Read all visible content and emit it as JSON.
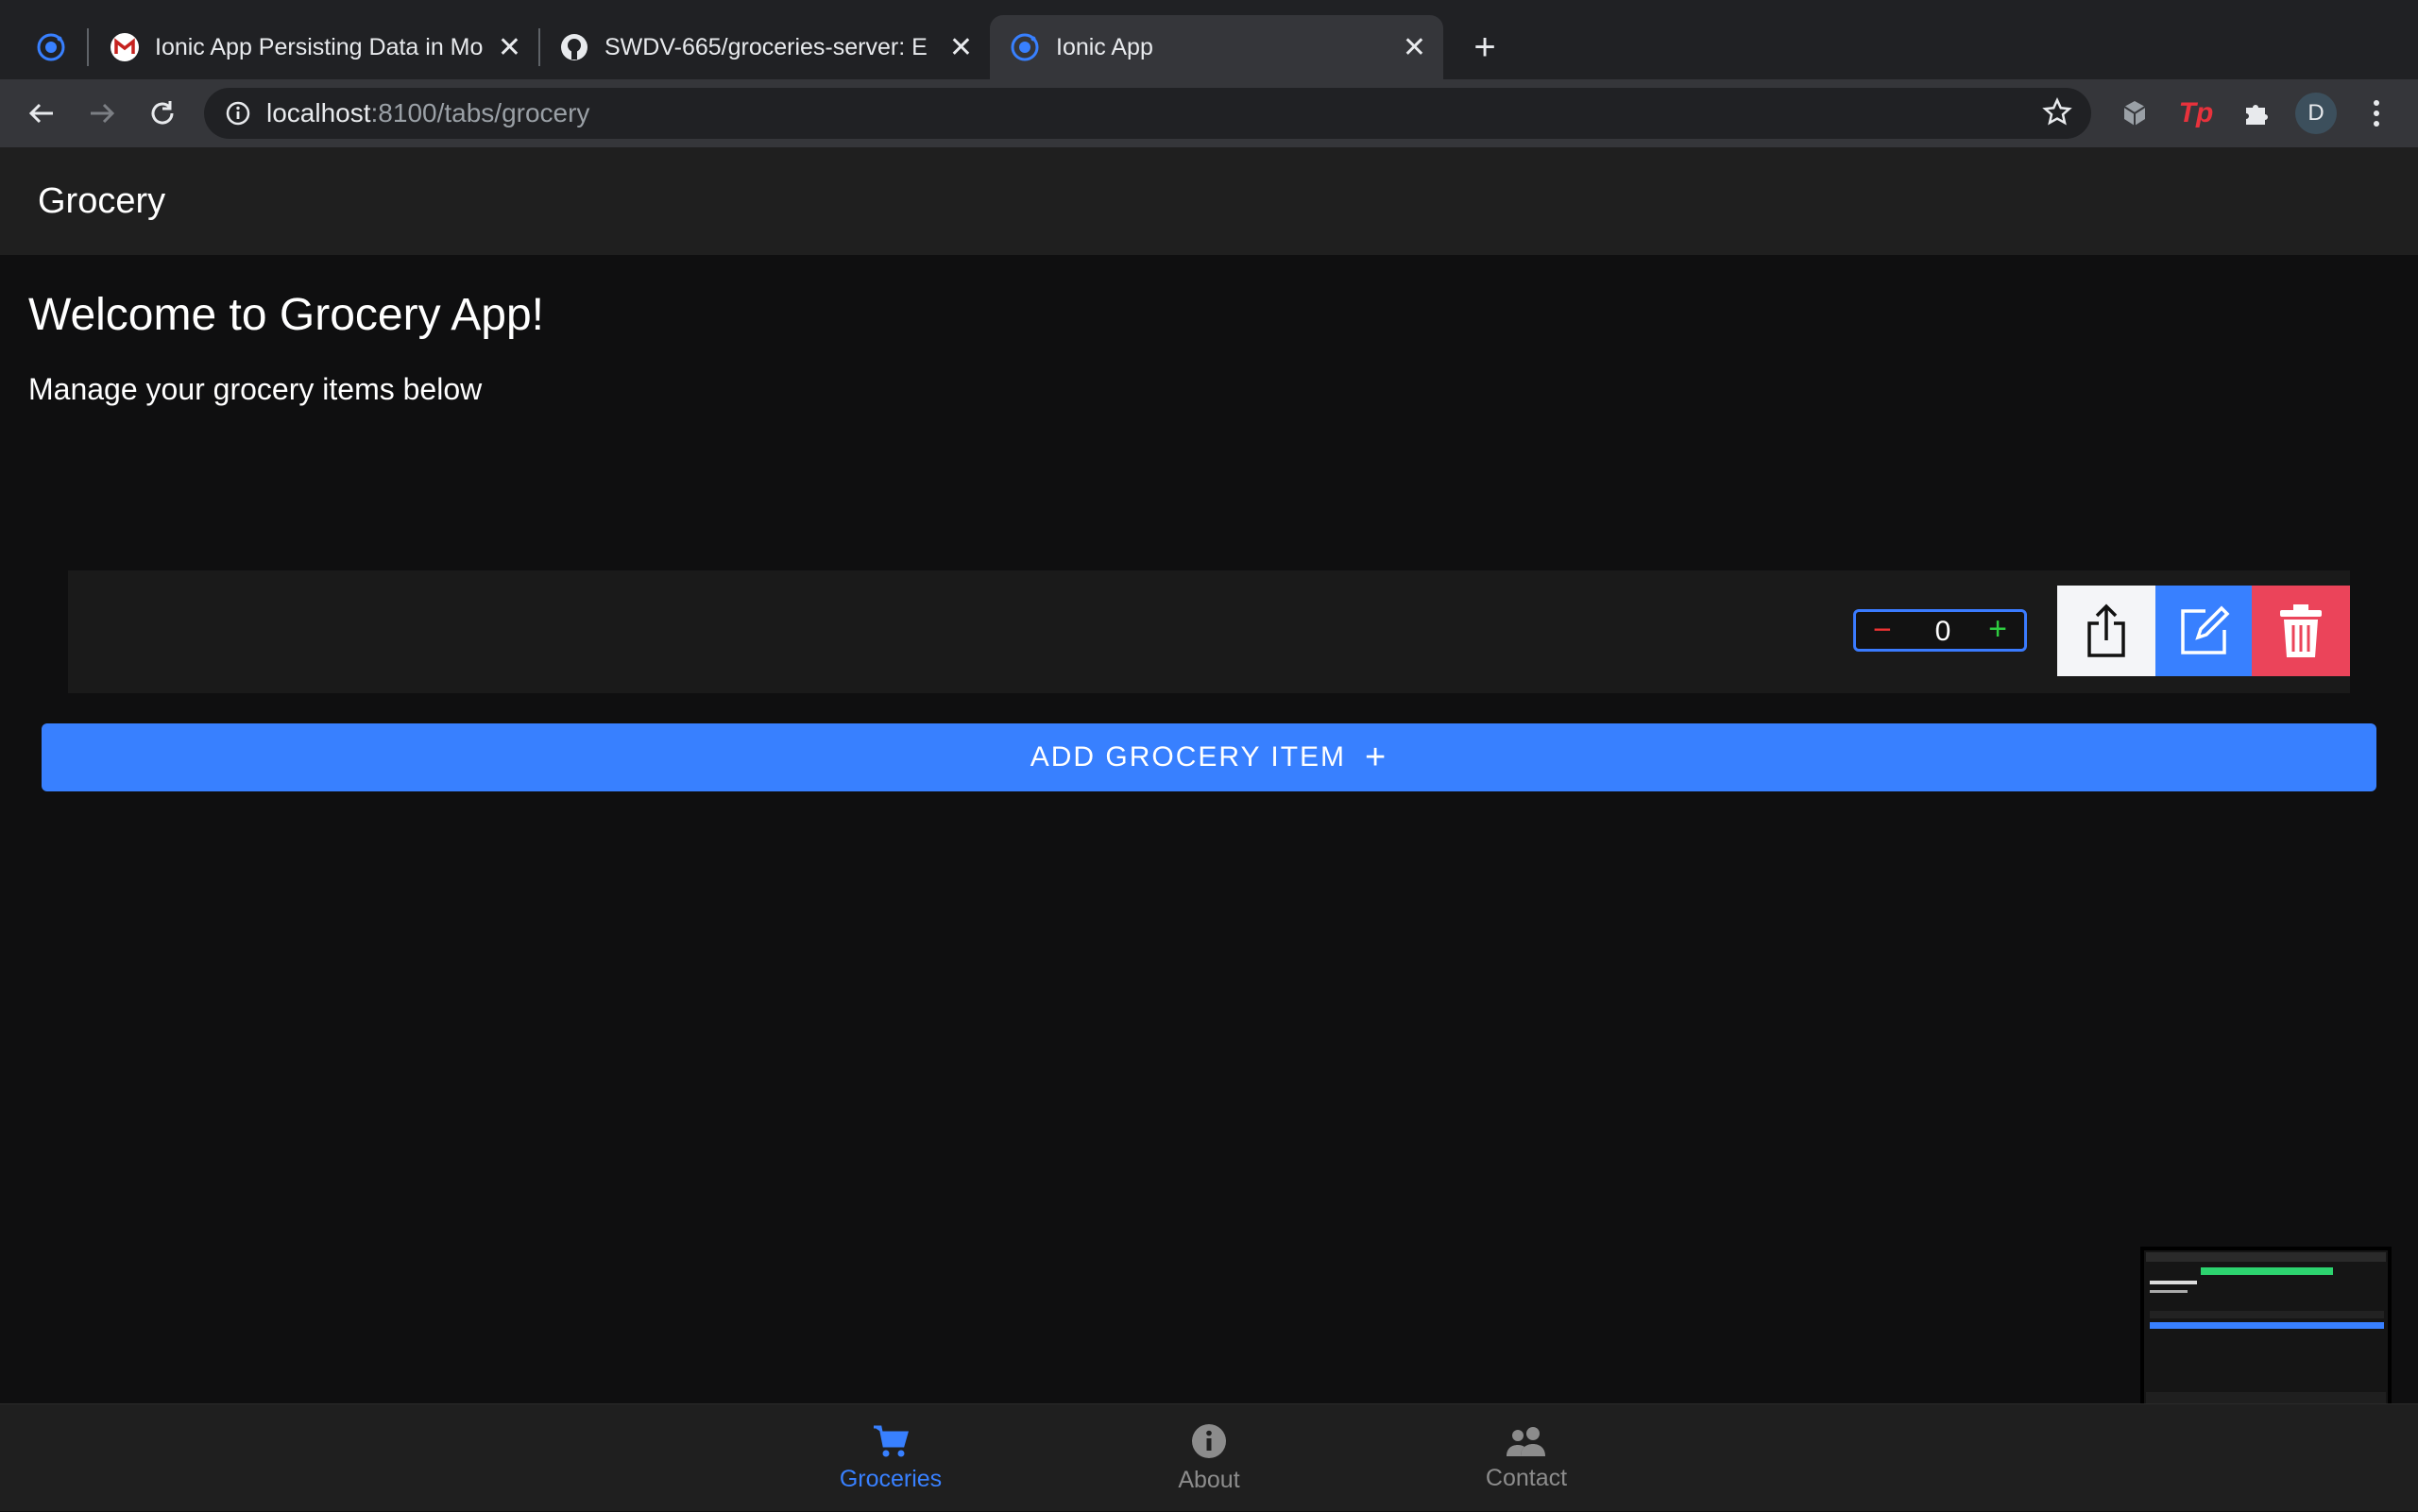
{
  "browser": {
    "tabs": [
      {
        "title": "Ionic App Persisting Data in Mo",
        "active": false
      },
      {
        "title": "SWDV-665/groceries-server: E",
        "active": false
      },
      {
        "title": "Ionic App",
        "active": true
      }
    ],
    "url_host": "localhost",
    "url_path": ":8100/tabs/grocery",
    "profile_initial": "D",
    "extension_label": "Tp"
  },
  "header": {
    "title": "Grocery"
  },
  "main": {
    "welcome": "Welcome to Grocery App!",
    "subtitle": "Manage your grocery items below",
    "item": {
      "quantity": "0",
      "quantity_minus": "−",
      "quantity_plus": "+"
    },
    "add_button_label": "ADD GROCERY ITEM",
    "add_button_icon": "+"
  },
  "tabbar": {
    "tabs": [
      {
        "label": "Groceries",
        "icon": "cart-icon",
        "active": true
      },
      {
        "label": "About",
        "icon": "info-icon",
        "active": false
      },
      {
        "label": "Contact",
        "icon": "people-icon",
        "active": false
      }
    ]
  },
  "colors": {
    "primary": "#3880ff",
    "danger": "#eb445a",
    "success": "#2ecc40",
    "light": "#f4f5f8"
  }
}
